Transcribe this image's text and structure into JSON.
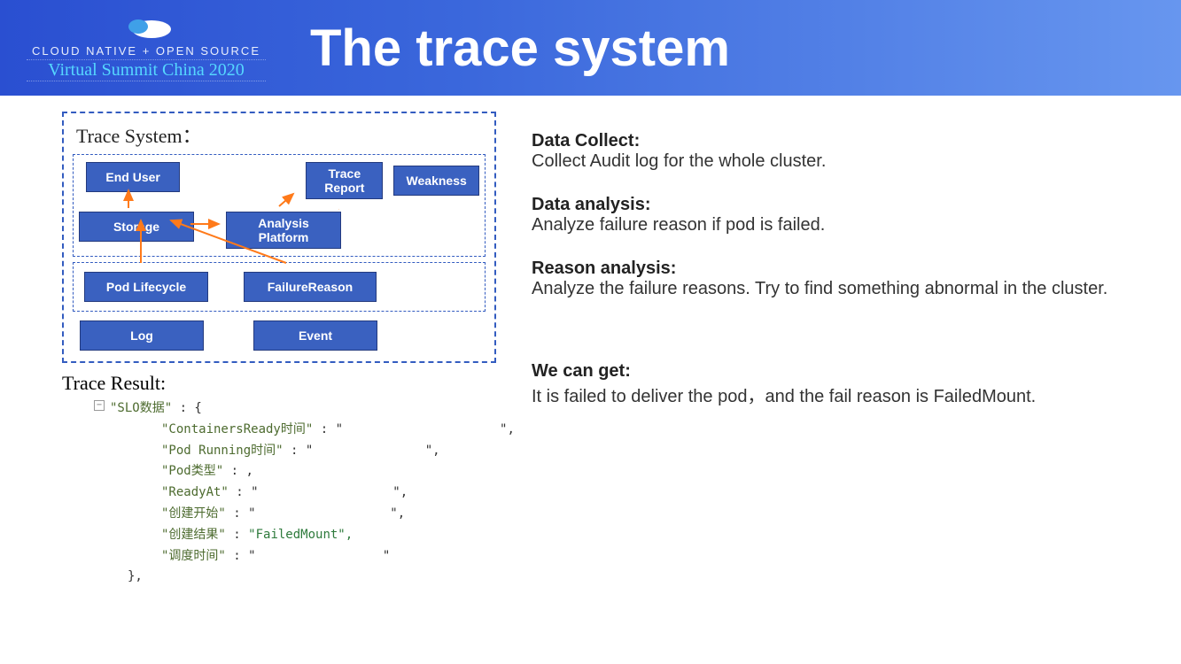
{
  "header": {
    "logo_line1": "CLOUD NATIVE + OPEN SOURCE",
    "logo_line2": "Virtual Summit China 2020",
    "title": "The trace system"
  },
  "diagram": {
    "title": "Trace System：",
    "end_user": "End User",
    "trace_report": "Trace\nReport",
    "weakness": "Weakness",
    "storage": "Storage",
    "analysis": "Analysis\nPlatform",
    "pod_lifecycle": "Pod Lifecycle",
    "failure_reason": "FailureReason",
    "log": "Log",
    "event": "Event"
  },
  "trace_result": {
    "label": "Trace Result:",
    "root": "\"SLO数据\" ",
    "rows": [
      {
        "k": "\"ContainersReady时间\"",
        "v": "\"                     \","
      },
      {
        "k": "\"Pod Running时间\"",
        "v": "\"               \","
      },
      {
        "k": "\"Pod类型\"",
        "v": ","
      },
      {
        "k": "\"ReadyAt\"",
        "v": "\"                  \","
      },
      {
        "k": "\"创建开始\"",
        "v": "\"                  \","
      },
      {
        "k": "\"创建结果\"",
        "v": "\"FailedMount\","
      },
      {
        "k": "\"调度时间\"",
        "v": "\"                 \""
      }
    ],
    "close": "},"
  },
  "right": {
    "s1h": "Data Collect:",
    "s1b": "Collect Audit log for the whole cluster.",
    "s2h": "Data analysis:",
    "s2b": "Analyze failure reason if pod is failed.",
    "s3h": "Reason analysis:",
    "s3b": "Analyze the failure reasons. Try to find something abnormal in the cluster.",
    "s4h": "We can get:",
    "s4b": "It is failed to deliver the pod，and the fail reason is FailedMount."
  }
}
